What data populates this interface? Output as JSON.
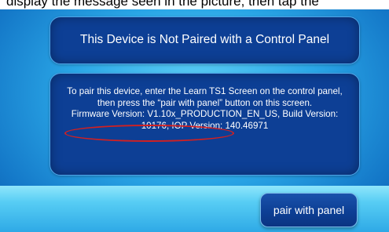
{
  "caption_fragment": "display the message seen in the picture, then tap the",
  "title_panel": {
    "text": "This Device is Not Paired with a Control Panel"
  },
  "info_panel": {
    "instructions": "To pair this device, enter the Learn TS1 Screen on the control panel, then press the “pair with panel” button on this screen.",
    "firmware_line": "Firmware Version: V1.10x_PRODUCTION_EN_US, Build Version: 10176, IOP Version: 140.46971"
  },
  "highlight_color": "#d42020",
  "pair_button": {
    "label": "pair with panel"
  }
}
